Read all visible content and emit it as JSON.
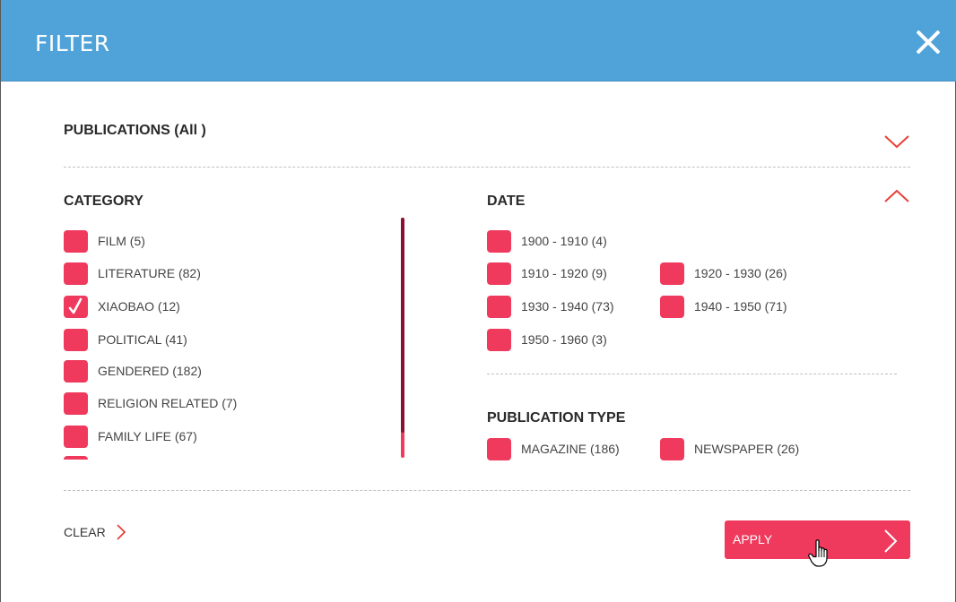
{
  "header": {
    "title": "FILTER",
    "close_icon": "close-x-icon"
  },
  "publications": {
    "title": "PUBLICATIONS (All )",
    "state": "collapsed",
    "chevron_icon": "chevron-down-icon"
  },
  "category": {
    "title": "CATEGORY",
    "items": [
      {
        "label": "FILM (5)",
        "checked": false
      },
      {
        "label": "LITERATURE (82)",
        "checked": false
      },
      {
        "label": "XIAOBAO (12)",
        "checked": true
      },
      {
        "label": "POLITICAL (41)",
        "checked": false
      },
      {
        "label": "GENDERED (182)",
        "checked": false
      },
      {
        "label": "RELIGION RELATED (7)",
        "checked": false
      },
      {
        "label": "FAMILY LIFE (67)",
        "checked": false
      }
    ]
  },
  "date": {
    "title": "DATE",
    "state": "expanded",
    "chevron_icon": "chevron-up-icon",
    "items": [
      {
        "label": "1900 - 1910 (4)",
        "checked": false
      },
      {
        "label": "1910 - 1920 (9)",
        "checked": false
      },
      {
        "label": "1920 - 1930 (26)",
        "checked": false
      },
      {
        "label": "1930 - 1940 (73)",
        "checked": false
      },
      {
        "label": "1940 - 1950 (71)",
        "checked": false
      },
      {
        "label": "1950 - 1960 (3)",
        "checked": false
      }
    ]
  },
  "publication_type": {
    "title": "PUBLICATION TYPE",
    "items": [
      {
        "label": "MAGAZINE (186)",
        "checked": false
      },
      {
        "label": "NEWSPAPER (26)",
        "checked": false
      }
    ]
  },
  "footer": {
    "clear_label": "CLEAR",
    "apply_label": "APPLY",
    "arrow_icon": "chevron-right-icon"
  },
  "colors": {
    "header_bg": "#4fa3d9",
    "accent": "#ef3a5d",
    "scroll_thumb": "#8c1130",
    "chevron": "#e8403a"
  }
}
